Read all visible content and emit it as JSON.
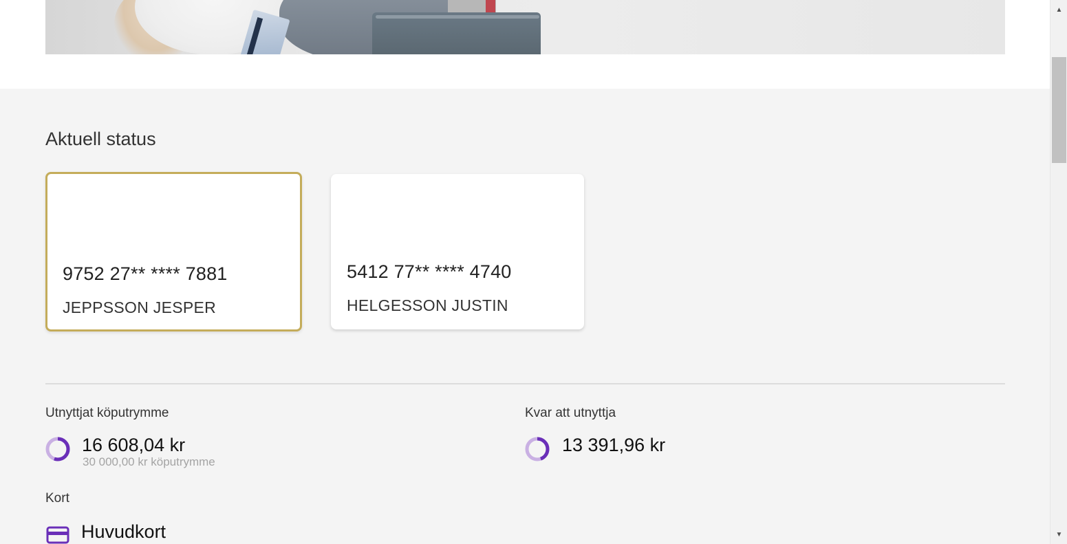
{
  "section": {
    "title": "Aktuell status"
  },
  "cards": [
    {
      "number": "9752 27** **** 7881",
      "holder": "JEPPSSON JESPER",
      "selected": true
    },
    {
      "number": "5412 77** **** 4740",
      "holder": "HELGESSON JUSTIN",
      "selected": false
    }
  ],
  "stats": {
    "used": {
      "label": "Utnyttjat köputrymme",
      "amount": "16 608,04 kr",
      "limit_text": "30 000,00 kr köputrymme",
      "fraction": 0.554
    },
    "remaining": {
      "label": "Kvar att utnyttja",
      "amount": "13 391,96 kr",
      "fraction": 0.446
    }
  },
  "kort": {
    "label": "Kort",
    "name": "Huvudkort"
  },
  "colors": {
    "accent_purple": "#6a2fb8",
    "ring_light": "#c9b0e3",
    "selected_border": "#c4ac5a",
    "section_background": "#f4f4f4"
  },
  "icons": {
    "ring": "donut-progress-icon",
    "kort": "credit-card-icon",
    "scroll_up": "triangle-up-icon",
    "scroll_down": "triangle-down-icon"
  }
}
